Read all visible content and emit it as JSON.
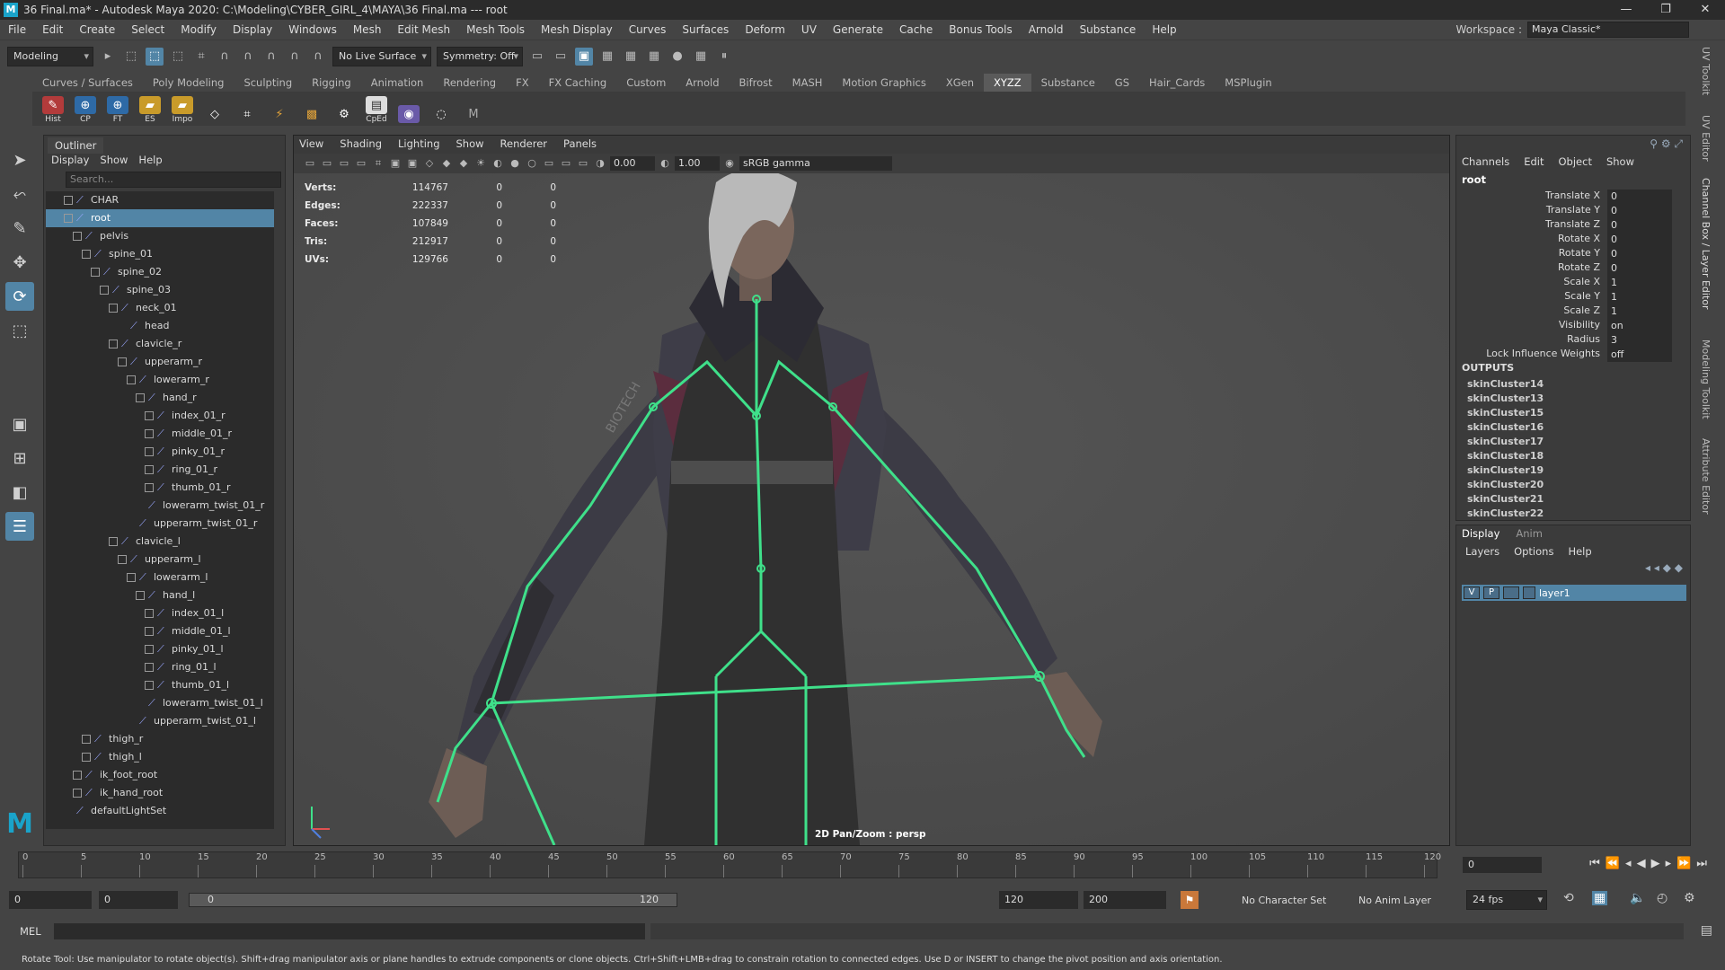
{
  "window": {
    "title": "36 Final.ma* - Autodesk Maya 2020: C:\\Modeling\\CYBER_GIRL_4\\MAYA\\36 Final.ma  ---  root",
    "minimize": "—",
    "maximize": "❐",
    "close": "✕"
  },
  "menubar": {
    "items": [
      "File",
      "Edit",
      "Create",
      "Select",
      "Modify",
      "Display",
      "Windows",
      "Mesh",
      "Edit Mesh",
      "Mesh Tools",
      "Mesh Display",
      "Curves",
      "Surfaces",
      "Deform",
      "UV",
      "Generate",
      "Cache",
      "Bonus Tools",
      "Arnold",
      "Substance",
      "Help"
    ],
    "workspace_label": "Workspace :",
    "workspace_value": "Maya Classic*"
  },
  "status_line": {
    "mode": "Modeling",
    "live_surface": "No Live Surface",
    "symmetry": "Symmetry: Off"
  },
  "shelf": {
    "tabs": [
      "Curves / Surfaces",
      "Poly Modeling",
      "Sculpting",
      "Rigging",
      "Animation",
      "Rendering",
      "FX",
      "FX Caching",
      "Custom",
      "Arnold",
      "Bifrost",
      "MASH",
      "Motion Graphics",
      "XGen",
      "XYZZ",
      "Substance",
      "GS",
      "Hair_Cards",
      "MSPlugin"
    ],
    "active_tab": "XYZZ",
    "buttons": [
      "Hist",
      "CP",
      "FT",
      "ES",
      "Impo",
      "",
      "",
      "",
      "",
      "",
      "CpEd",
      "",
      ""
    ]
  },
  "outliner": {
    "title": "Outliner",
    "menu": [
      "Display",
      "Show",
      "Help"
    ],
    "search_placeholder": "Search...",
    "rows": [
      {
        "label": "CHAR",
        "indent": 2,
        "exp": "+",
        "selected": false
      },
      {
        "label": "root",
        "indent": 2,
        "exp": "−",
        "selected": true
      },
      {
        "label": "pelvis",
        "indent": 3,
        "exp": "−",
        "selected": false
      },
      {
        "label": "spine_01",
        "indent": 4,
        "exp": "−",
        "selected": false
      },
      {
        "label": "spine_02",
        "indent": 5,
        "exp": "−",
        "selected": false
      },
      {
        "label": "spine_03",
        "indent": 6,
        "exp": "−",
        "selected": false
      },
      {
        "label": "neck_01",
        "indent": 7,
        "exp": "−",
        "selected": false
      },
      {
        "label": "head",
        "indent": 8,
        "exp": "",
        "selected": false
      },
      {
        "label": "clavicle_r",
        "indent": 7,
        "exp": "−",
        "selected": false
      },
      {
        "label": "upperarm_r",
        "indent": 8,
        "exp": "−",
        "selected": false
      },
      {
        "label": "lowerarm_r",
        "indent": 9,
        "exp": "−",
        "selected": false
      },
      {
        "label": "hand_r",
        "indent": 10,
        "exp": "−",
        "selected": false
      },
      {
        "label": "index_01_r",
        "indent": 11,
        "exp": "+",
        "selected": false
      },
      {
        "label": "middle_01_r",
        "indent": 11,
        "exp": "+",
        "selected": false
      },
      {
        "label": "pinky_01_r",
        "indent": 11,
        "exp": "+",
        "selected": false
      },
      {
        "label": "ring_01_r",
        "indent": 11,
        "exp": "+",
        "selected": false
      },
      {
        "label": "thumb_01_r",
        "indent": 11,
        "exp": "+",
        "selected": false
      },
      {
        "label": "lowerarm_twist_01_r",
        "indent": 10,
        "exp": "",
        "selected": false
      },
      {
        "label": "upperarm_twist_01_r",
        "indent": 9,
        "exp": "",
        "selected": false
      },
      {
        "label": "clavicle_l",
        "indent": 7,
        "exp": "−",
        "selected": false
      },
      {
        "label": "upperarm_l",
        "indent": 8,
        "exp": "−",
        "selected": false
      },
      {
        "label": "lowerarm_l",
        "indent": 9,
        "exp": "−",
        "selected": false
      },
      {
        "label": "hand_l",
        "indent": 10,
        "exp": "−",
        "selected": false
      },
      {
        "label": "index_01_l",
        "indent": 11,
        "exp": "+",
        "selected": false
      },
      {
        "label": "middle_01_l",
        "indent": 11,
        "exp": "+",
        "selected": false
      },
      {
        "label": "pinky_01_l",
        "indent": 11,
        "exp": "+",
        "selected": false
      },
      {
        "label": "ring_01_l",
        "indent": 11,
        "exp": "+",
        "selected": false
      },
      {
        "label": "thumb_01_l",
        "indent": 11,
        "exp": "+",
        "selected": false
      },
      {
        "label": "lowerarm_twist_01_l",
        "indent": 10,
        "exp": "",
        "selected": false
      },
      {
        "label": "upperarm_twist_01_l",
        "indent": 9,
        "exp": "",
        "selected": false
      },
      {
        "label": "thigh_r",
        "indent": 4,
        "exp": "+",
        "selected": false
      },
      {
        "label": "thigh_l",
        "indent": 4,
        "exp": "+",
        "selected": false
      },
      {
        "label": "ik_foot_root",
        "indent": 3,
        "exp": "+",
        "selected": false
      },
      {
        "label": "ik_hand_root",
        "indent": 3,
        "exp": "+",
        "selected": false
      },
      {
        "label": "defaultLightSet",
        "indent": 2,
        "exp": "",
        "selected": false
      }
    ]
  },
  "viewport": {
    "menu": [
      "View",
      "Shading",
      "Lighting",
      "Show",
      "Renderer",
      "Panels"
    ],
    "exposure": "0.00",
    "gamma": "1.00",
    "colorspace": "sRGB gamma",
    "hud": [
      {
        "label": "Verts:",
        "value": "114767",
        "c1": "0",
        "c2": "0"
      },
      {
        "label": "Edges:",
        "value": "222337",
        "c1": "0",
        "c2": "0"
      },
      {
        "label": "Faces:",
        "value": "107849",
        "c1": "0",
        "c2": "0"
      },
      {
        "label": "Tris:",
        "value": "212917",
        "c1": "0",
        "c2": "0"
      },
      {
        "label": "UVs:",
        "value": "129766",
        "c1": "0",
        "c2": "0"
      }
    ],
    "camera_label": "2D Pan/Zoom : persp",
    "jacket_text": "BIOTECH"
  },
  "channelbox": {
    "menu": [
      "Channels",
      "Edit",
      "Object",
      "Show"
    ],
    "node": "root",
    "attrs": [
      {
        "name": "Translate X",
        "value": "0"
      },
      {
        "name": "Translate Y",
        "value": "0"
      },
      {
        "name": "Translate Z",
        "value": "0"
      },
      {
        "name": "Rotate X",
        "value": "0"
      },
      {
        "name": "Rotate Y",
        "value": "0"
      },
      {
        "name": "Rotate Z",
        "value": "0"
      },
      {
        "name": "Scale X",
        "value": "1"
      },
      {
        "name": "Scale Y",
        "value": "1"
      },
      {
        "name": "Scale Z",
        "value": "1"
      },
      {
        "name": "Visibility",
        "value": "on"
      },
      {
        "name": "Radius",
        "value": "3"
      },
      {
        "name": "Lock Influence Weights",
        "value": "off"
      }
    ],
    "outputs_label": "OUTPUTS",
    "outputs": [
      "skinCluster14",
      "skinCluster13",
      "skinCluster15",
      "skinCluster16",
      "skinCluster17",
      "skinCluster18",
      "skinCluster19",
      "skinCluster20",
      "skinCluster21",
      "skinCluster22"
    ]
  },
  "layers": {
    "tabs": [
      "Display",
      "Anim"
    ],
    "menu": [
      "Layers",
      "Options",
      "Help"
    ],
    "layer": {
      "v": "V",
      "p": "P",
      "name": "layer1"
    }
  },
  "right_tabs": [
    "UV Toolkit",
    "UV Editor",
    "Channel Box / Layer Editor",
    "Modeling Toolkit",
    "Attribute Editor"
  ],
  "timeline": {
    "ticks": [
      "0",
      "5",
      "10",
      "15",
      "20",
      "25",
      "30",
      "35",
      "40",
      "45",
      "50",
      "55",
      "60",
      "65",
      "70",
      "75",
      "80",
      "85",
      "90",
      "95",
      "100",
      "105",
      "110",
      "115",
      "120"
    ],
    "current_frame": "0"
  },
  "range": {
    "start": "0",
    "playback_start": "0",
    "slider_start": "0",
    "slider_end": "120",
    "playback_end": "120",
    "end": "200",
    "character_set": "No Character Set",
    "anim_layer": "No Anim Layer",
    "fps": "24 fps"
  },
  "cmdline": {
    "label": "MEL"
  },
  "helpline": {
    "text": "Rotate Tool: Use manipulator to rotate object(s). Shift+drag manipulator axis or plane handles to extrude components or clone objects. Ctrl+Shift+LMB+drag to constrain rotation to connected edges. Use D or INSERT to change the pivot position and axis orientation."
  }
}
